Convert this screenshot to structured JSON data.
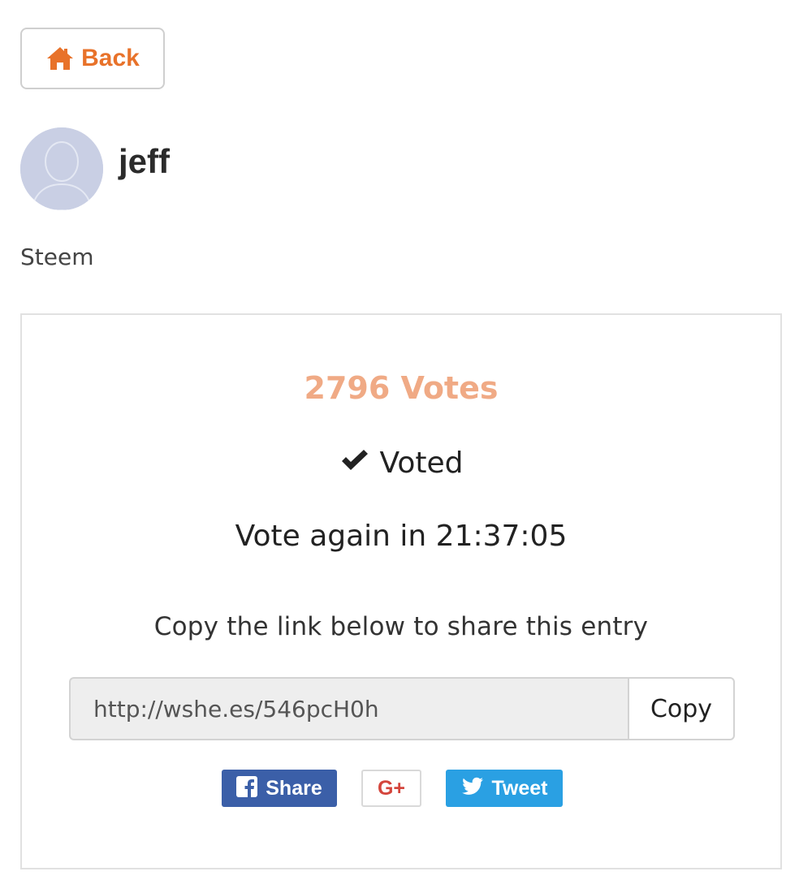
{
  "back_button": {
    "label": "Back",
    "icon": "home-icon",
    "color": "#e8722a"
  },
  "profile": {
    "username": "jeff",
    "avatar_icon": "user-placeholder-icon"
  },
  "entry": {
    "title": "Steem"
  },
  "card": {
    "votes_label": "2796 Votes",
    "votes_color": "#f0aa85",
    "voted_label": "Voted",
    "voted_icon": "checkmark-icon",
    "countdown_label": "Vote again in 21:37:05",
    "share_instruction": "Copy the link below to share this entry",
    "share_link": "http://wshe.es/546pcH0h",
    "copy_label": "Copy"
  },
  "social": {
    "facebook": {
      "label": "Share",
      "icon": "facebook-icon",
      "color": "#3b5fa8"
    },
    "google_plus": {
      "label": "G+",
      "icon": "google-plus-icon",
      "color": "#d4453c"
    },
    "twitter": {
      "label": "Tweet",
      "icon": "twitter-icon",
      "color": "#2aa0e3"
    }
  }
}
